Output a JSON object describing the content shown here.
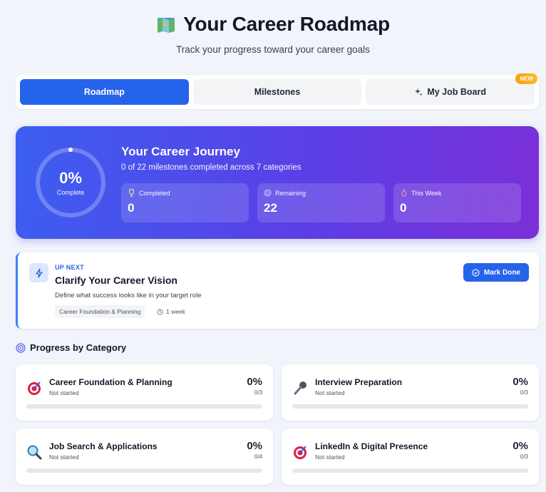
{
  "header": {
    "title": "Your Career Roadmap",
    "subtitle": "Track your progress toward your career goals",
    "icon": "map-icon"
  },
  "tabs": [
    {
      "label": "Roadmap",
      "active": true
    },
    {
      "label": "Milestones",
      "active": false
    },
    {
      "label": "My Job Board",
      "active": false,
      "icon": "sparkles-icon",
      "badge": "NEW"
    }
  ],
  "journey": {
    "percent_label": "0%",
    "percent_sub": "Complete",
    "progress": 0,
    "title": "Your Career Journey",
    "subtitle": "0 of 22 milestones completed across 7 categories",
    "stats": [
      {
        "label": "Completed",
        "value": "0",
        "icon": "trophy-icon"
      },
      {
        "label": "Remaining",
        "value": "22",
        "icon": "target-icon"
      },
      {
        "label": "This Week",
        "value": "0",
        "icon": "flame-icon"
      }
    ]
  },
  "up_next": {
    "tag": "UP NEXT",
    "title": "Clarify Your Career Vision",
    "description": "Define what success looks like in your target role",
    "category": "Career Foundation & Planning",
    "duration": "1 week",
    "button_label": "Mark Done"
  },
  "categories_section": {
    "title": "Progress by Category",
    "items": [
      {
        "name": "Career Foundation & Planning",
        "status": "Not started",
        "percent": "0%",
        "count": "0/3",
        "progress": 0,
        "icon": "dart-target-icon"
      },
      {
        "name": "Interview Preparation",
        "status": "Not started",
        "percent": "0%",
        "count": "0/3",
        "progress": 0,
        "icon": "microphone-icon"
      },
      {
        "name": "Job Search & Applications",
        "status": "Not started",
        "percent": "0%",
        "count": "0/4",
        "progress": 0,
        "icon": "magnifier-icon"
      },
      {
        "name": "LinkedIn & Digital Presence",
        "status": "Not started",
        "percent": "0%",
        "count": "0/3",
        "progress": 0,
        "icon": "dart-target-icon"
      }
    ]
  },
  "colors": {
    "accent": "#2563eb",
    "gradient_start": "#3b5ff0",
    "gradient_end": "#7c2fd8",
    "badge": "#f59e0b"
  }
}
